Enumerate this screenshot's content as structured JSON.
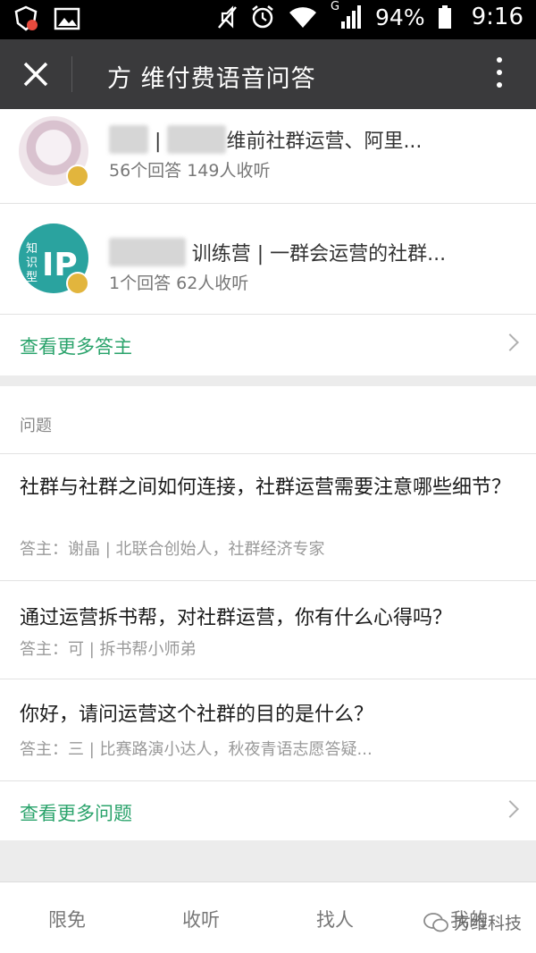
{
  "status_bar": {
    "network_type": "G",
    "battery": "94%",
    "time": "9:16",
    "icons": [
      "shield-badge-icon",
      "image-icon",
      "mute-icon",
      "alarm-icon",
      "wifi-icon",
      "signal-icon",
      "battery-icon"
    ]
  },
  "header": {
    "title": "方 维付费语音问答",
    "close_icon": "close-icon",
    "more_icon": "more-vertical-icon"
  },
  "authors": [
    {
      "name_visible": "维前社群运营、阿里...",
      "stats": "56个回答  149人收听"
    },
    {
      "name_visible": "训练营 | 一群会运营的社群...",
      "stats": "1个回答  62人收听"
    }
  ],
  "more_authors_label": "查看更多答主",
  "questions_section": {
    "title": "问题",
    "items": [
      {
        "title": "社群与社群之间如何连接，社群运营需要注意哪些细节？",
        "meta": "答主：谢晶 | 北联合创始人，社群经济专家"
      },
      {
        "title": "通过运营拆书帮，对社群运营，你有什么心得吗？",
        "meta": "答主：可 | 拆书帮小师弟"
      },
      {
        "title": "你好，请问运营这个社群的目的是什么？",
        "meta": "答主：三 | 比赛路演小达人，秋夜青语志愿答疑..."
      }
    ],
    "more_label": "查看更多问题"
  },
  "bottom_nav": {
    "items": [
      "限免",
      "收听",
      "找人",
      "我的"
    ]
  },
  "watermark": "方维科技",
  "colors": {
    "accent_green": "#2aa36b",
    "title_bar": "#3a3a3c",
    "badge": "#e2b53d"
  }
}
